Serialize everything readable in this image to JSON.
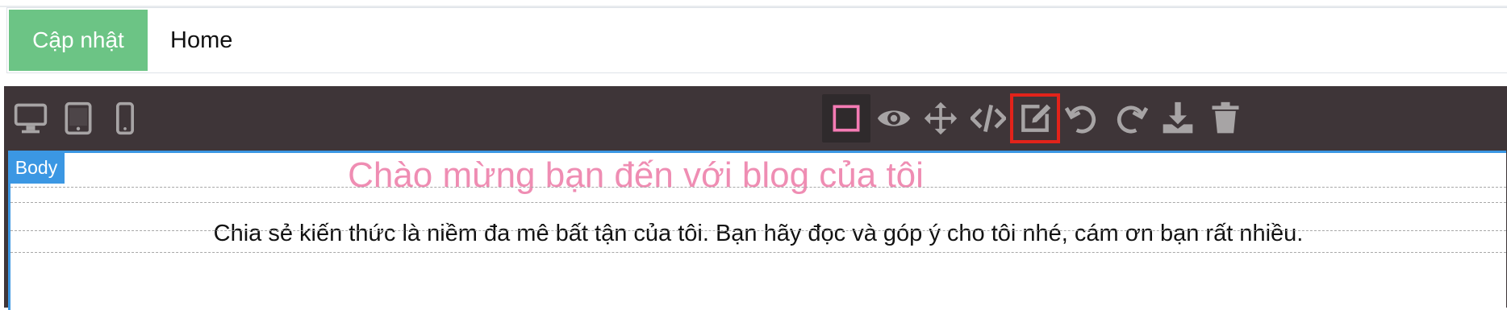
{
  "header": {
    "update_label": "Cập nhật",
    "page_title_value": "Home"
  },
  "toolbar": {
    "device_icons": [
      "desktop-icon",
      "tablet-icon",
      "mobile-icon"
    ],
    "action_icons": [
      "component-outline-icon",
      "preview-icon",
      "move-icon",
      "code-icon",
      "edit-icon",
      "undo-icon",
      "redo-icon",
      "download-icon",
      "trash-icon"
    ],
    "highlighted": "edit-icon",
    "icon_color": "#a7a4a5",
    "active_icon_color": "#f47bb4"
  },
  "canvas": {
    "body_badge": "Body",
    "heading": "Chào mừng bạn đến với blog của tôi",
    "paragraph": "Chia sẻ kiến thức là niềm đa mê bất tận của tôi. Bạn hãy đọc và góp ý cho tôi nhé, cám ơn bạn rất nhiều.",
    "accent_color": "#3b97e3",
    "heading_color": "#ef8db3"
  }
}
